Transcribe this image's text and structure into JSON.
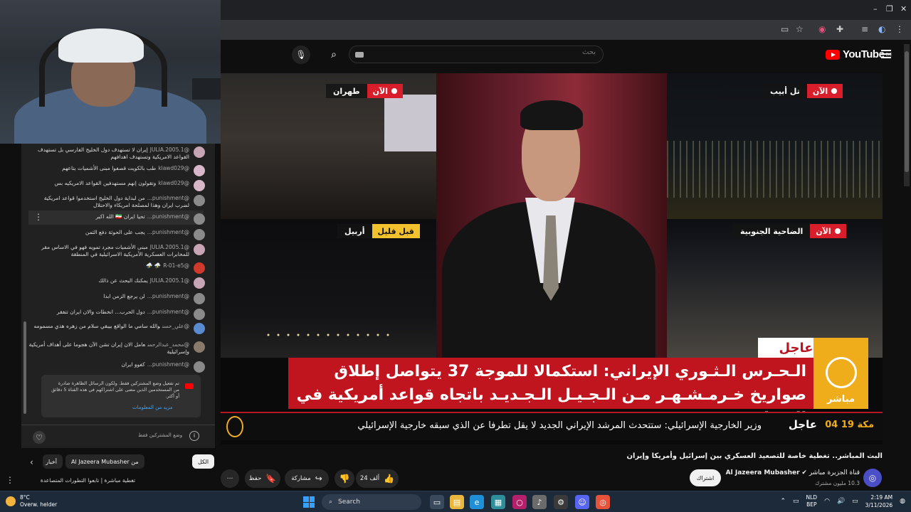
{
  "browser": {
    "window_controls": [
      "–",
      "❐",
      "✕"
    ],
    "toolbar_icons": [
      "screen-icon",
      "star-icon",
      "extension-icon",
      "puzzle-icon",
      "list-icon",
      "profile-icon",
      "menu-icon"
    ]
  },
  "youtube": {
    "logo": "YouTube",
    "region": "BE",
    "search_placeholder": "بحث"
  },
  "player": {
    "cams": {
      "top_left": {
        "city": "طهران",
        "status": "الآن"
      },
      "bottom_left": {
        "city": "أربيل",
        "status": "قبل قليل"
      },
      "top_right": {
        "city": "تل أبيب",
        "status": "الآن"
      },
      "bottom_right": {
        "city": "الضاحية الجنوبية",
        "status": "الآن"
      }
    },
    "breaking": "عاجل",
    "logo_text": "مباشر",
    "headline": "الـحـرس الـثـوري الإيراني: استكمالا للموجة 37 يتواصل إطلاق صواريخ خـرمـشـهـر مـن الـجـيـل الـجـديـد باتجاه قواعد أمريكية في المنطقة",
    "ticker": {
      "time": "مكة 19 04",
      "urgent": "عاجل",
      "text": "وزير الخارجية الإسرائيلي: ستتحدث   المرشد الإيراني الجديد لا يقل تطرفا عن الذي سبقه   خارجية الإسرائيلي"
    }
  },
  "video": {
    "title": "البث المباشر.. تغطية خاصة للتصعيد العسكري بين إسرائيل وأمريكا وإيران",
    "channel": "Al Jazeera Mubasher",
    "channel_prefix": "قناة الجزيرة مباشر",
    "subs": "10.3 مليون مشترك",
    "subscribe": "اشتراك",
    "likes": "24 ألف",
    "share": "مشاركة",
    "save": "حفظ",
    "more": "⋯"
  },
  "chat": {
    "messages": [
      {
        "user": "@JULIA.2005.1",
        "text": "إيران لا تستهدف دول الخليج الفارسي بل تستهدف القواعد الامريكية وتستهدف اهدافهم",
        "color": "#c7a5b5"
      },
      {
        "user": "@klawd029",
        "text": "طب بالكويت قصفوا مبنى الأشميات بتاعهم",
        "color": "#d8b8c8"
      },
      {
        "user": "@klawd029",
        "text": "وتقولون إنهم مستهدفين القواعد الامريكيه بس",
        "color": "#d8b8c8"
      },
      {
        "user": "@punishment...",
        "text": "من لبداية دول الخليج استخدموا قواعد امريكية لضرب ايران وهذا لمصلحة امريكاء والاحتلال",
        "color": "#8a8a8a"
      },
      {
        "user": "@punishment...",
        "text": "تحيا ايران 🇮🇷 الله اكبر",
        "color": "#8a8a8a"
      },
      {
        "user": "@punishment...",
        "text": "يجب على الحوثة دفع الثمن",
        "color": "#8a8a8a"
      },
      {
        "user": "@JULIA.2005.1",
        "text": "مبنى الأشميات مجرد تمويه فهو في الاساس مقر للمخابرات العسكرية الأمريكية الاسرائيلية في المنطقة",
        "color": "#c7a5b5"
      },
      {
        "user": "@R-01-e5",
        "text": "⛈️ ⛈️",
        "color": "#d03a2c"
      },
      {
        "user": "@JULIA.2005.1",
        "text": "يمكنك البحث عن ذالك",
        "color": "#c7a5b5"
      },
      {
        "user": "@punishment...",
        "text": "لن يرجع الزمن ابدا",
        "color": "#8a8a8a"
      },
      {
        "user": "@punishment...",
        "text": "دول الحرب... انخطات والان ايران تتفقر",
        "color": "#8a8a8a"
      },
      {
        "user": "@علي_حسن",
        "text": "والله سامي ما الواقع بيبقي سلام من زهره هذي مسمومه",
        "color": "#5a8ad0"
      },
      {
        "user": "@محمد_عبدالرحمن",
        "text": "عامل الان إيران تشن الآن هجوما على أهداف أمريكية وإسرائيلية",
        "color": "#8a7a6a"
      },
      {
        "user": "@punishment...",
        "text": "كفوو ايران",
        "color": "#8a8a8a"
      }
    ],
    "notice_text": "تم تفعيل وضع المشتركين فقط. ولكون الرسائل الظاهرة صادرة من المستخدمين الذين مضى على اشتراكهم في هذه القناة 5 دقائق أو أكثر.",
    "notice_link": "مزيد من المعلومات",
    "mode_label": "وضع المشتركين فقط"
  },
  "below_chat": {
    "chips": [
      "الكل",
      "من Al Jazeera Mubasher",
      "قناة الجزيرة مباشر",
      "أخبار"
    ],
    "item": "تغطية مباشرة | تابعوا التطورات المتصاعدة"
  },
  "taskbar": {
    "temp": "8°C",
    "weather": "Overw. helder",
    "search": "Search",
    "lang": "NLD",
    "lang2": "BEP",
    "time": "2:19 AM",
    "date": "3/11/2026"
  },
  "colors": {
    "accent": "#c0141f",
    "brand": "#f0ad1b",
    "live": "#d81e2b",
    "before": "#f2c22e"
  }
}
